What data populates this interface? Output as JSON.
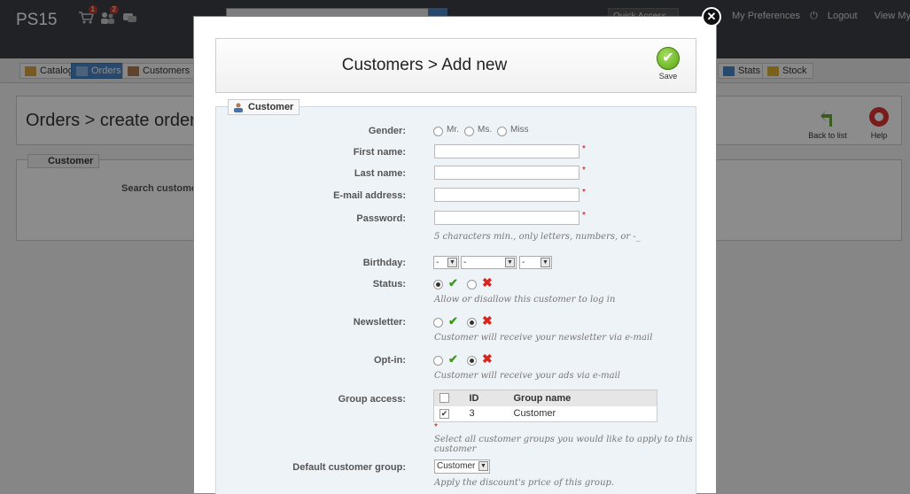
{
  "topbar": {
    "shop_name": "PS15",
    "cart_badge": "1",
    "customers_badge": "2",
    "quick_access": "Quick Access",
    "preferences": "My Preferences",
    "logout": "Logout",
    "view_shop": "View My Shop"
  },
  "tabs": {
    "catalog": "Catalog",
    "orders": "Orders",
    "customers": "Customers",
    "stats": "Stats",
    "stock": "Stock"
  },
  "page": {
    "title": "Orders > create order",
    "back_to_list": "Back to list",
    "help": "Help",
    "customer_legend": "Customer",
    "search_customer": "Search customer"
  },
  "modal": {
    "title": "Customers > Add new",
    "save": "Save",
    "legend": "Customer",
    "gender_label": "Gender:",
    "gender_options": [
      "Mr.",
      "Ms.",
      "Miss"
    ],
    "first_name_label": "First name:",
    "last_name_label": "Last name:",
    "email_label": "E-mail address:",
    "password_label": "Password:",
    "password_hint": "5 characters min., only letters, numbers, or -_",
    "required_mark": "*",
    "birthday_label": "Birthday:",
    "birthday_day": "-",
    "birthday_month": "-",
    "birthday_year": "-",
    "status_label": "Status:",
    "status_hint": "Allow or disallow this customer to log in",
    "newsletter_label": "Newsletter:",
    "newsletter_hint": "Customer will receive your newsletter via e-mail",
    "optin_label": "Opt-in:",
    "optin_hint": "Customer will receive your ads via e-mail",
    "group_access_label": "Group access:",
    "group_table": {
      "col_id": "ID",
      "col_name": "Group name",
      "rows": [
        {
          "id": "3",
          "name": "Customer",
          "checked": true
        }
      ]
    },
    "group_hint": "Select all customer groups you would like to apply to this customer",
    "default_group_label": "Default customer group:",
    "default_group_value": "Customer",
    "default_group_hint": "Apply the discount's price of this group."
  },
  "colors": {
    "accent": "#4a86c8",
    "check": "#3e9a1c",
    "cross": "#d9261c",
    "required": "#cc0000"
  }
}
